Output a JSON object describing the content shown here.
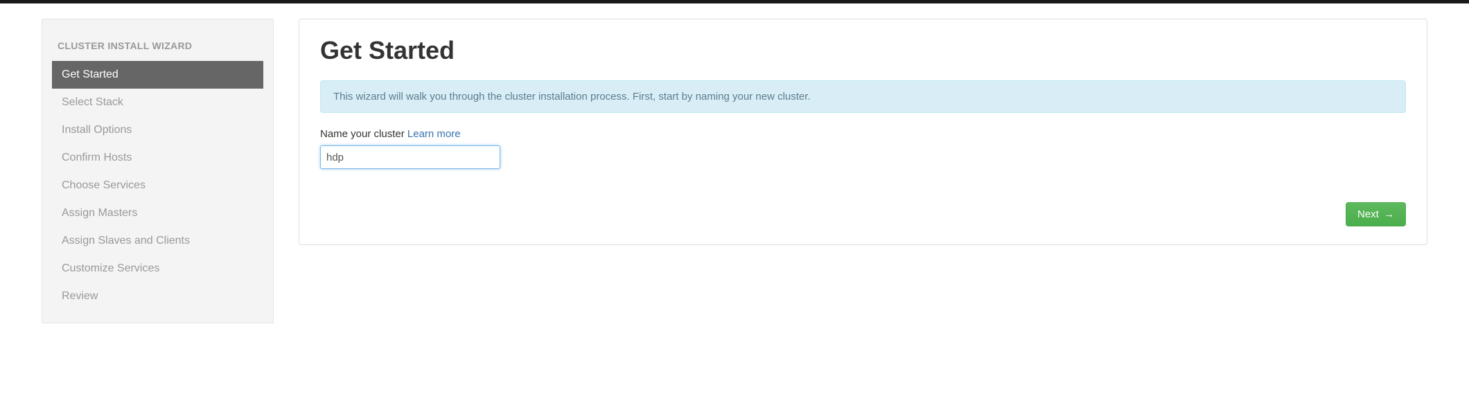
{
  "sidebar": {
    "title": "CLUSTER INSTALL WIZARD",
    "steps": [
      {
        "label": "Get Started",
        "active": true
      },
      {
        "label": "Select Stack",
        "active": false
      },
      {
        "label": "Install Options",
        "active": false
      },
      {
        "label": "Confirm Hosts",
        "active": false
      },
      {
        "label": "Choose Services",
        "active": false
      },
      {
        "label": "Assign Masters",
        "active": false
      },
      {
        "label": "Assign Slaves and Clients",
        "active": false
      },
      {
        "label": "Customize Services",
        "active": false
      },
      {
        "label": "Review",
        "active": false
      }
    ]
  },
  "main": {
    "title": "Get Started",
    "info_message": "This wizard will walk you through the cluster installation process. First, start by naming your new cluster.",
    "name_label": "Name your cluster",
    "learn_more": "Learn more",
    "cluster_name_value": "hdp",
    "next_button": "Next",
    "next_arrow": "→"
  }
}
